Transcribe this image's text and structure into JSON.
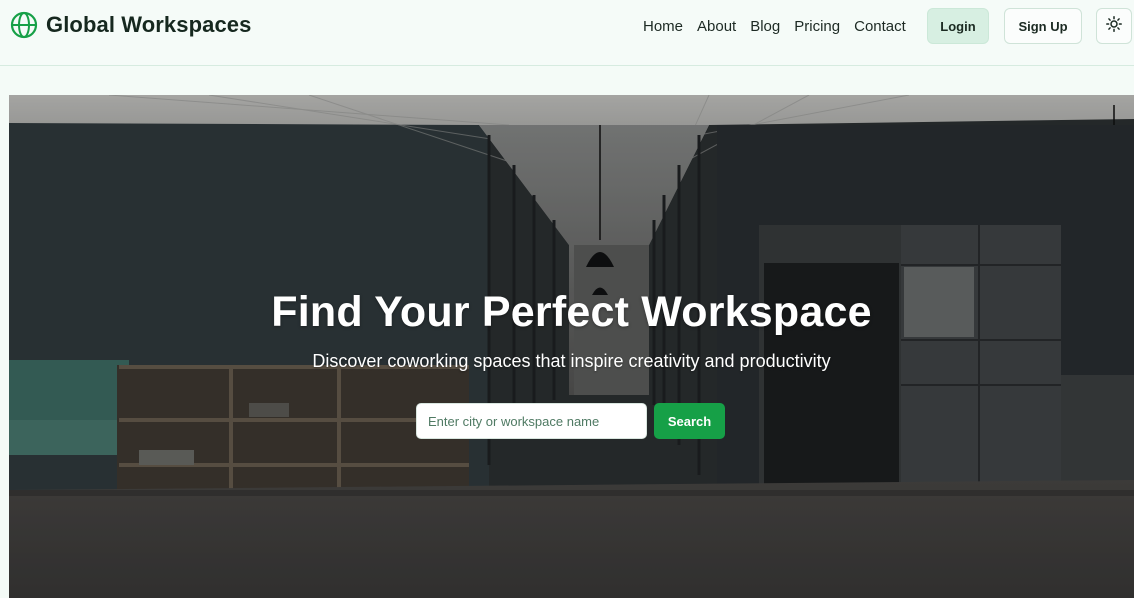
{
  "brand": {
    "name": "Global Workspaces",
    "icon": "globe-icon"
  },
  "nav": {
    "items": [
      "Home",
      "About",
      "Blog",
      "Pricing",
      "Contact"
    ]
  },
  "auth": {
    "login_label": "Login",
    "signup_label": "Sign Up"
  },
  "theme_toggle": {
    "icon": "sun-icon"
  },
  "hero": {
    "title": "Find Your Perfect Workspace",
    "subtitle": "Discover coworking spaces that inspire creativity and productivity",
    "search_placeholder": "Enter city or workspace name",
    "search_value": "",
    "search_button": "Search"
  },
  "colors": {
    "accent": "#16a047",
    "login_bg": "#d7efe2",
    "header_bg": "#f5fbf8"
  }
}
